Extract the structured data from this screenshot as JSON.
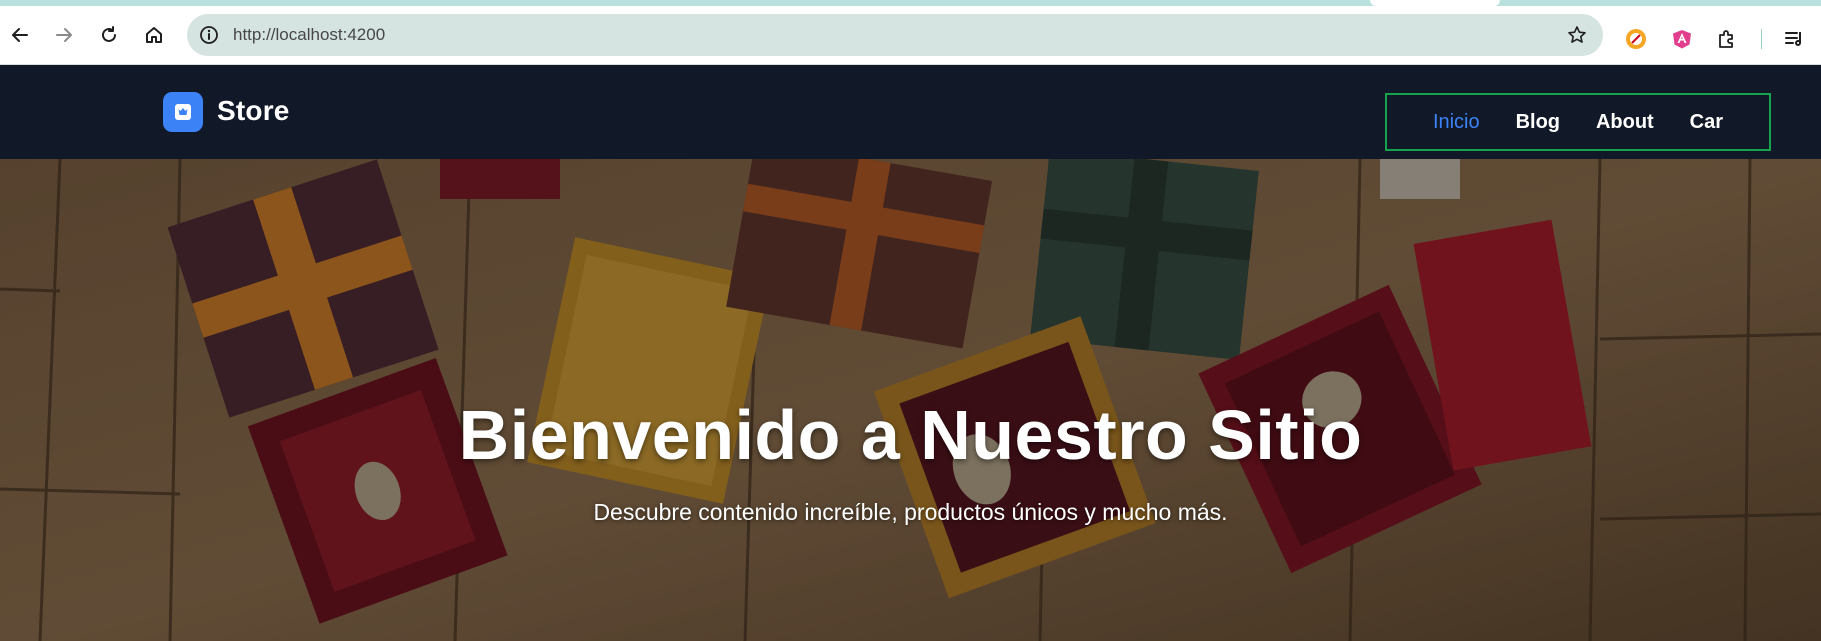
{
  "browser": {
    "url": "http://localhost:4200",
    "nav_icons": [
      "back-arrow-icon",
      "forward-arrow-icon",
      "reload-icon",
      "home-icon"
    ],
    "omnibox_icons": [
      "site-info-icon",
      "bookmark-star-icon"
    ],
    "extension_icons": [
      "extension-orange-icon",
      "angular-devtools-icon",
      "extensions-puzzle-icon",
      "reading-list-icon"
    ]
  },
  "site": {
    "brand": "Store",
    "nav": [
      {
        "label": "Inicio",
        "active": true
      },
      {
        "label": "Blog",
        "active": false
      },
      {
        "label": "About",
        "active": false
      },
      {
        "label": "Car",
        "active": false
      }
    ]
  },
  "hero": {
    "title": "Bienvenido a Nuestro Sitio",
    "subtitle": "Descubre contenido increíble, productos únicos y mucho más."
  },
  "colors": {
    "header_bg": "#111827",
    "accent": "#3b82f6",
    "nav_border": "#16a34a",
    "omnibox_bg": "#d5e3e1"
  }
}
